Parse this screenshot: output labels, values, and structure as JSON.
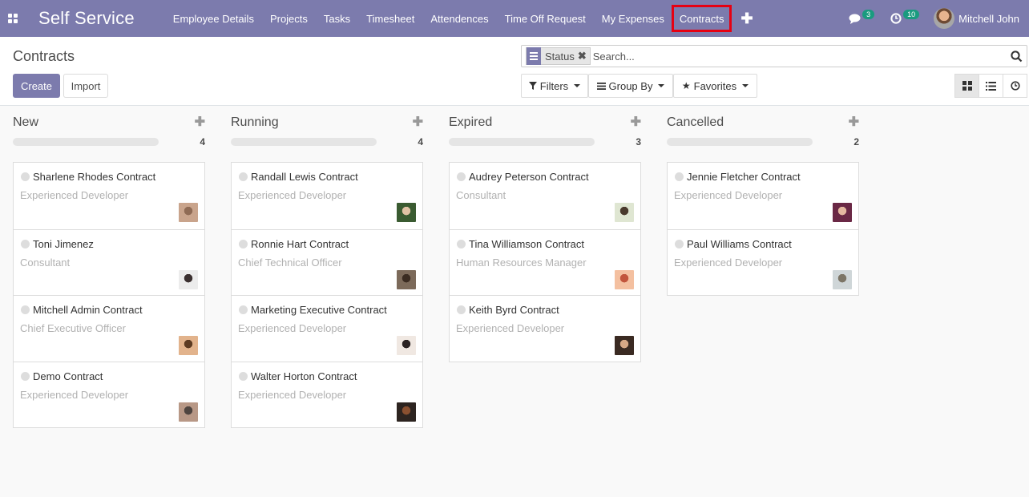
{
  "navbar": {
    "brand": "Self Service",
    "menu": [
      "Employee Details",
      "Projects",
      "Tasks",
      "Timesheet",
      "Attendences",
      "Time Off Request",
      "My Expenses",
      "Contracts"
    ],
    "active_index": 7,
    "messages_count": "3",
    "activities_count": "10",
    "user_name": "Mitchell John"
  },
  "control": {
    "title": "Contracts",
    "create_label": "Create",
    "import_label": "Import",
    "facet": "Status",
    "search_placeholder": "Search...",
    "filters_label": "Filters",
    "groupby_label": "Group By",
    "favorites_label": "Favorites"
  },
  "colors": {
    "brand": "#7c7bad",
    "active_outline": "#e60012",
    "badge": "#1a9b7f"
  },
  "columns": [
    {
      "title": "New",
      "count": "4",
      "cards": [
        {
          "title": "Sharlene Rhodes Contract",
          "sub": "Experienced Developer",
          "avatar": [
            "#c9a48c",
            "#8f6b55"
          ]
        },
        {
          "title": "Toni Jimenez",
          "sub": "Consultant",
          "avatar": [
            "#ececec",
            "#3b3030"
          ]
        },
        {
          "title": "Mitchell Admin Contract",
          "sub": "Chief Executive Officer",
          "avatar": [
            "#e2b38c",
            "#5d3b22"
          ]
        },
        {
          "title": "Demo Contract",
          "sub": "Experienced Developer",
          "avatar": [
            "#b89886",
            "#4f4540"
          ]
        }
      ]
    },
    {
      "title": "Running",
      "count": "4",
      "cards": [
        {
          "title": "Randall Lewis Contract",
          "sub": "Experienced Developer",
          "avatar": [
            "#3a5b31",
            "#e0c2a4"
          ]
        },
        {
          "title": "Ronnie Hart Contract",
          "sub": "Chief Technical Officer",
          "avatar": [
            "#7c6a5a",
            "#3b2c22"
          ]
        },
        {
          "title": "Marketing Executive Contract",
          "sub": "Experienced Developer",
          "avatar": [
            "#f0e8e2",
            "#2b2323"
          ]
        },
        {
          "title": "Walter Horton Contract",
          "sub": "Experienced Developer",
          "avatar": [
            "#2d2420",
            "#8a5030"
          ]
        }
      ]
    },
    {
      "title": "Expired",
      "count": "3",
      "cards": [
        {
          "title": "Audrey Peterson Contract",
          "sub": "Consultant",
          "avatar": [
            "#dfe6d2",
            "#4a3a2d"
          ]
        },
        {
          "title": "Tina Williamson Contract",
          "sub": "Human Resources Manager",
          "avatar": [
            "#f4c0a0",
            "#c2553c"
          ]
        },
        {
          "title": "Keith Byrd Contract",
          "sub": "Experienced Developer",
          "avatar": [
            "#3a2a22",
            "#d6a886"
          ]
        }
      ]
    },
    {
      "title": "Cancelled",
      "count": "2",
      "cards": [
        {
          "title": "Jennie Fletcher Contract",
          "sub": "Experienced Developer",
          "avatar": [
            "#6a2845",
            "#e4b8a0"
          ]
        },
        {
          "title": "Paul Williams Contract",
          "sub": "Experienced Developer",
          "avatar": [
            "#cfd6d8",
            "#7c7566"
          ]
        }
      ]
    }
  ]
}
